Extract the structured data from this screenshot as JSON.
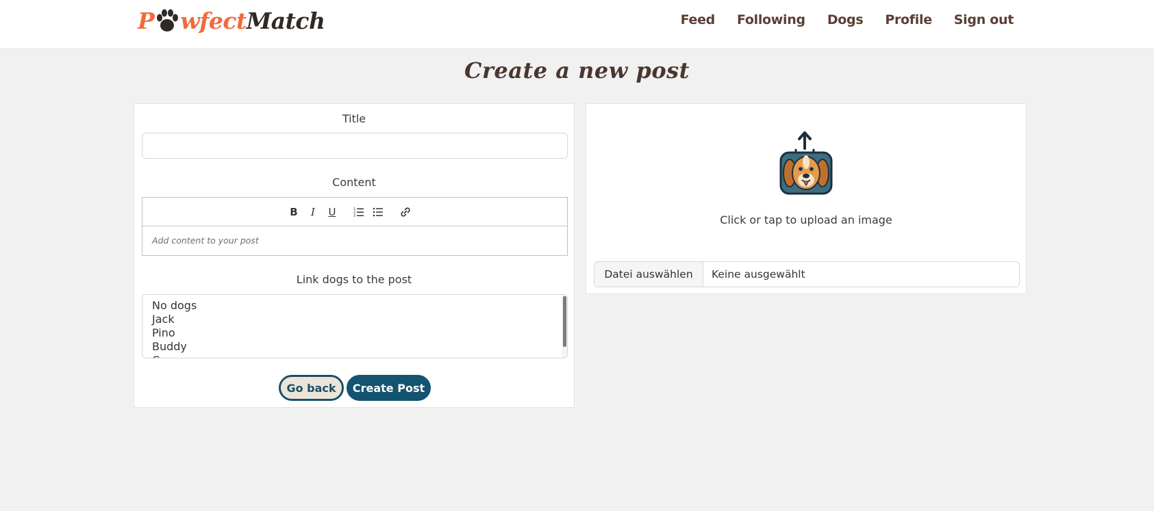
{
  "header": {
    "logo_parts": {
      "p": "P",
      "wfect": "wfect",
      "match": "Match"
    },
    "nav": [
      {
        "label": "Feed"
      },
      {
        "label": "Following"
      },
      {
        "label": "Dogs"
      },
      {
        "label": "Profile"
      },
      {
        "label": "Sign out"
      }
    ]
  },
  "page": {
    "title": "Create a new post"
  },
  "form": {
    "title_label": "Title",
    "title_value": "",
    "content_label": "Content",
    "content_placeholder": "Add content to your post",
    "toolbar": {
      "bold": "B",
      "italic": "I",
      "underline": "U"
    },
    "dogs_label": "Link dogs to the post",
    "dogs_options": [
      "No dogs",
      "Jack",
      "Pino",
      "Buddy",
      "C"
    ],
    "go_back_label": "Go back",
    "create_label": "Create Post"
  },
  "upload": {
    "text": "Click or tap to upload an image",
    "file_button": "Datei auswählen",
    "file_name": "Keine ausgewählt"
  },
  "colors": {
    "accent_orange": "#f26a3a",
    "primary_blue": "#135470",
    "nav_brown": "#5a3e34",
    "title_brown": "#4a362e"
  }
}
